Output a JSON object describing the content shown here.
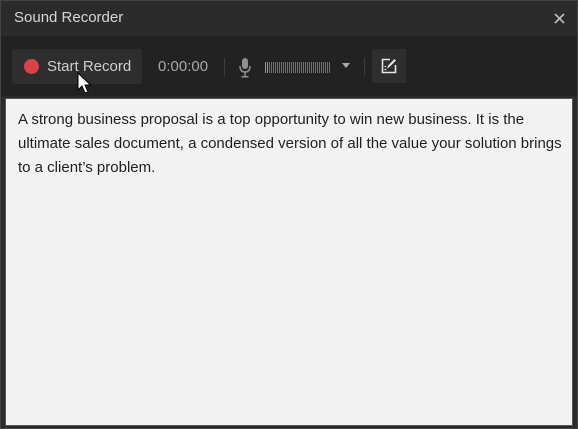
{
  "window": {
    "title": "Sound Recorder"
  },
  "toolbar": {
    "record_label": "Start Record",
    "timer": "0:00:00",
    "meter_level": 0.05
  },
  "content": {
    "text": "A strong business proposal is a top opportunity to win new business. It is the ultimate sales document, a condensed version of all the value your solution brings to a client’s problem."
  },
  "icons": {
    "record": "record-dot-icon",
    "close": "close-icon",
    "mic": "microphone-icon",
    "dropdown": "dropdown-arrow-icon",
    "edit": "edit-note-icon"
  },
  "colors": {
    "record_red": "#d8434b",
    "meter_green": "#6cbf4a",
    "toolbar_bg": "#222222",
    "content_bg": "#f2f2f2"
  }
}
